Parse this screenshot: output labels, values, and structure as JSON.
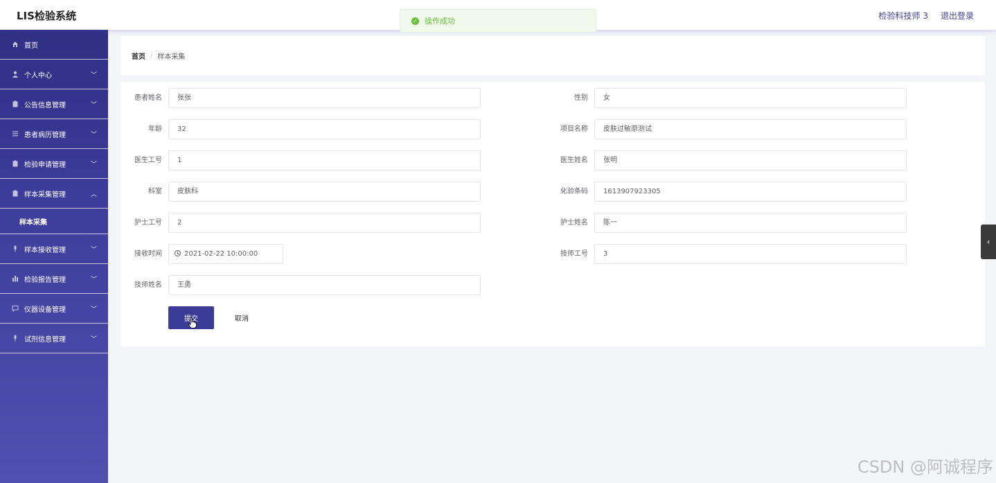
{
  "header": {
    "app_title": "LIS检验系统",
    "user": "检验科技师 3",
    "logout": "退出登录"
  },
  "toast": {
    "message": "操作成功"
  },
  "sidebar": {
    "items": [
      {
        "label": "首页",
        "icon": "home-icon"
      },
      {
        "label": "个人中心",
        "icon": "user-icon"
      },
      {
        "label": "公告信息管理",
        "icon": "clipboard-icon"
      },
      {
        "label": "患者病历管理",
        "icon": "list-icon"
      },
      {
        "label": "检验申请管理",
        "icon": "clipboard-icon"
      },
      {
        "label": "样本采集管理",
        "icon": "clipboard-icon"
      },
      {
        "label": "样本接收管理",
        "icon": "microphone-icon"
      },
      {
        "label": "检验报告管理",
        "icon": "chart-icon"
      },
      {
        "label": "仪器设备管理",
        "icon": "chat-icon"
      },
      {
        "label": "试剂信息管理",
        "icon": "microphone-icon"
      }
    ],
    "sub_item": "样本采集"
  },
  "breadcrumb": {
    "home": "首页",
    "separator": "/",
    "current": "样本采集"
  },
  "form": {
    "patient_name": {
      "label": "患者姓名",
      "value": "张张"
    },
    "gender": {
      "label": "性别",
      "value": "女"
    },
    "age": {
      "label": "年龄",
      "value": "32"
    },
    "project_name": {
      "label": "项目名称",
      "value": "皮肤过敏原测试"
    },
    "doctor_id": {
      "label": "医生工号",
      "value": "1"
    },
    "doctor_name": {
      "label": "医生姓名",
      "value": "张明"
    },
    "department": {
      "label": "科室",
      "value": "皮肤科"
    },
    "barcode": {
      "label": "化验条码",
      "value": "1613907923305"
    },
    "nurse_id": {
      "label": "护士工号",
      "value": "2"
    },
    "nurse_name": {
      "label": "护士姓名",
      "value": "陈一"
    },
    "receive_time": {
      "label": "接收时间",
      "value": "2021-02-22 10:00:00"
    },
    "tech_id": {
      "label": "技师工号",
      "value": "3"
    },
    "tech_name": {
      "label": "技师姓名",
      "value": "王勇"
    },
    "submit": "提交",
    "cancel": "取消"
  },
  "watermark": "CSDN @阿诚程序",
  "colors": {
    "primary": "#3b3b98",
    "sidebar_top": "#2f2f85",
    "sidebar_bottom": "#5050b0",
    "success": "#67c23a"
  }
}
